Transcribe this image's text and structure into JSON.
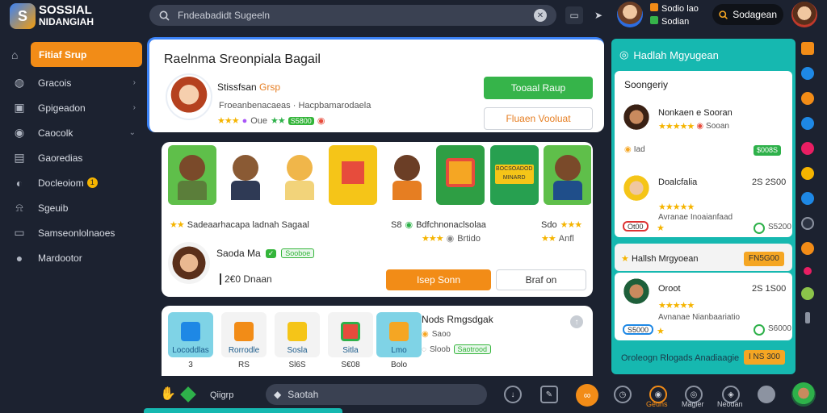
{
  "app": {
    "brand_line1": "SOSSIAL",
    "brand_line2": "NIDANGIAH",
    "search_placeholder": "Fndeabadidt Sugeeln"
  },
  "topbar": {
    "user_line1": "Sodio lao",
    "user_line2": "Sodian",
    "action_label": "Sodagean"
  },
  "sidebar": {
    "items": [
      {
        "label": "Fitiaf Srup",
        "icon": "home-icon",
        "active": true
      },
      {
        "label": "Gracois",
        "icon": "palette-icon"
      },
      {
        "label": "Gpigeadon",
        "icon": "box-icon"
      },
      {
        "label": "Caocolk",
        "icon": "gamepad-icon"
      },
      {
        "label": "Gaoredias",
        "icon": "card-icon"
      },
      {
        "label": "Docleoiom",
        "icon": "chat-icon",
        "badge": "1"
      },
      {
        "label": "Sgeuib",
        "icon": "bell-icon"
      },
      {
        "label": "Samseonlolnaoes",
        "icon": "monitor-icon"
      },
      {
        "label": "Mardootor",
        "icon": "globe-icon"
      }
    ]
  },
  "main": {
    "header": {
      "title": "Raelnma Sreonpiala Bagail",
      "name_prefix": "Stissfsan",
      "name_highlight": "Grsp",
      "subline": "Froeanbenacaeas · Hacpbamarodaela",
      "rating_text": "Oue",
      "rating_tag": "S5800",
      "btn_primary": "Tooaal Raup",
      "btn_secondary": "Fluaen Vooluat"
    },
    "feed": {
      "row1_left": "Sadeaarhacapa ladnah Sagaal",
      "row1_mid": "Bdfchnonaclsolaa",
      "row1_right": "Sdo",
      "row1_mid_prefix": "S8",
      "row2_mid": "Brtido",
      "row2_right": "Anfl",
      "post_name": "Saoda Ma",
      "post_tag": "Sooboe",
      "post_sub": "2€0 Dnaan",
      "btn_join": "Isep Sonn",
      "btn_other": "Braf on",
      "tile_banner": "BOCSOADOD MINARD"
    },
    "shop": {
      "products": [
        {
          "label": "Locoddlas",
          "value": "3",
          "color": "#7fd3e6"
        },
        {
          "label": "Rorrodle",
          "value": "RS",
          "color": "#f3f3f3"
        },
        {
          "label": "Sosla",
          "value": "Sl6S",
          "color": "#f3f3f3"
        },
        {
          "label": "Sitla",
          "value": "S€08",
          "color": "#f3f3f3"
        },
        {
          "label": "Lmo",
          "value": "Bolo",
          "color": "#7fd3e6"
        }
      ],
      "detail_title": "Nods Rmgsdgak",
      "detail_line1": "Saoo",
      "detail_line2": "Sloob",
      "detail_tag": "Saotrood"
    }
  },
  "right_panel": {
    "title": "Hadlah Mgyugean",
    "section1": "Soongeriy",
    "cards": [
      {
        "name": "Nonkaen e Sooran",
        "sub": "Sooan",
        "chip": "$008S",
        "extra": "Iad"
      },
      {
        "name": "Doalcfalia",
        "sub": "Avranae Inoaianfaad",
        "chip": "Ot00",
        "price": "2S 2S00",
        "extra": "S5200"
      }
    ],
    "section2": "Hallsh Mrgyoean",
    "section2_chip": "FN5G00",
    "card3": {
      "name": "Oroot",
      "sub": "Avnanae Nianbaariatio",
      "chip": "S5000",
      "price": "2S 1S00",
      "extra": "S6000"
    },
    "footer": "Oroleogn Rlogads Anadiaagie",
    "footer_chip": "I NS 300"
  },
  "bottom": {
    "left_label": "Qiigrp",
    "search_text": "Saotah",
    "labels": [
      "Geuns",
      "Magier",
      "Neodan"
    ]
  },
  "colors": {
    "accent_orange": "#f28c17",
    "accent_green": "#36b44a",
    "accent_teal": "#16b8b0",
    "accent_blue": "#3b82f6"
  }
}
